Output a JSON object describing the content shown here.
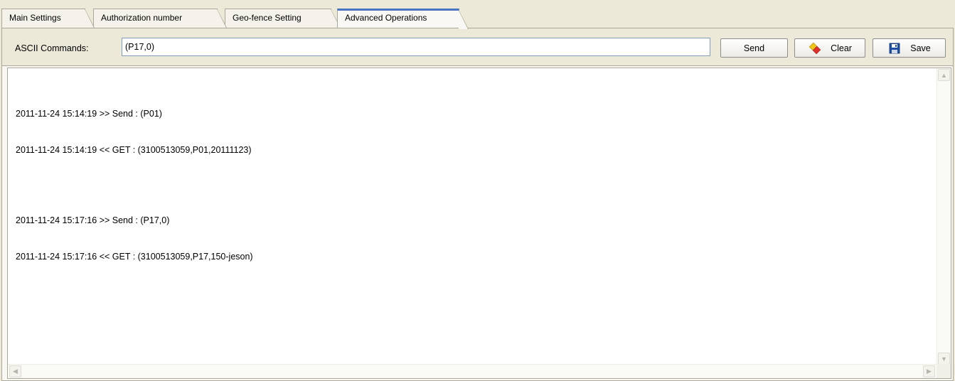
{
  "tabs": [
    {
      "label": "Main Settings"
    },
    {
      "label": "Authorization number"
    },
    {
      "label": "Geo-fence Setting"
    },
    {
      "label": "Advanced Operations"
    }
  ],
  "active_tab": "Advanced Operations",
  "command_bar": {
    "label": "ASCII Commands:",
    "input_value": "(P17,0)",
    "send_label": "Send",
    "clear_label": "Clear",
    "save_label": "Save"
  },
  "log": {
    "lines": [
      "2011-11-24 15:14:19 >> Send : (P01)",
      "2011-11-24 15:14:19 << GET : (3100513059,P01,20111123)",
      "2011-11-24 15:17:16 >> Send : (P17,0)",
      "2011-11-24 15:17:16 << GET : (3100513059,P17,150-jeson)"
    ]
  },
  "icons": {
    "clear": "eraser-icon",
    "save": "floppy-disk-icon",
    "scroll_up": "arrow-up-icon",
    "scroll_down": "arrow-down-icon",
    "scroll_left": "arrow-left-icon",
    "scroll_right": "arrow-right-icon"
  },
  "colors": {
    "active_tab_accent": "#4a73c2",
    "background": "#ece9d8"
  }
}
